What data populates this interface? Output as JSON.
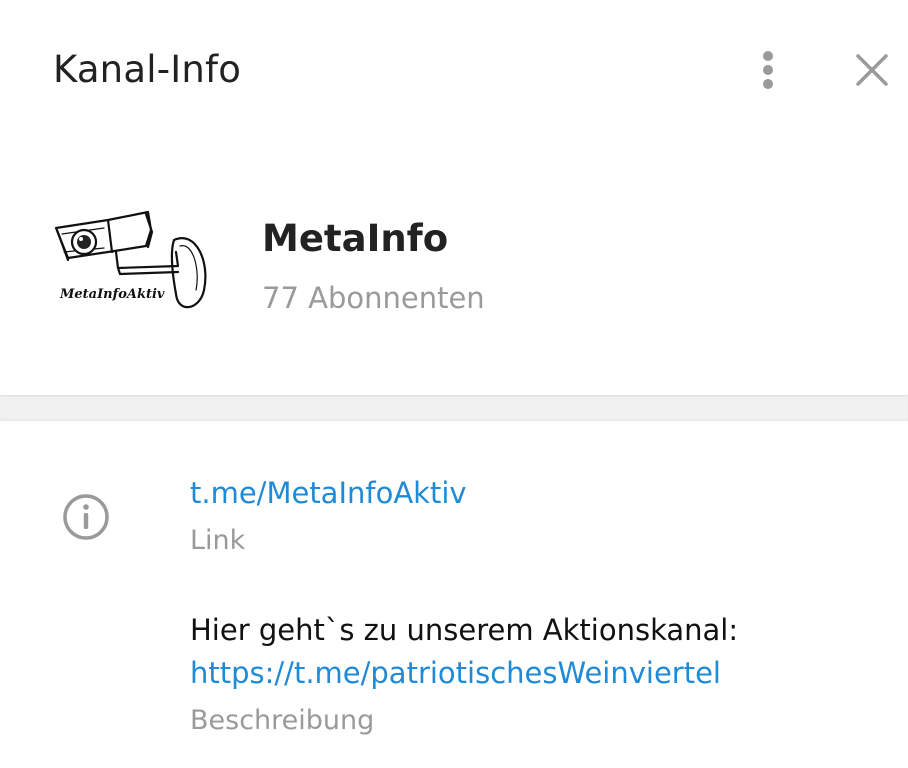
{
  "header": {
    "title": "Kanal-Info",
    "menu_icon": "more-vertical-icon",
    "close_icon": "close-icon"
  },
  "profile": {
    "avatar_icon": "security-camera-logo",
    "avatar_caption": "MetaInfoAktiv",
    "name": "MetaInfo",
    "subscribers": "77 Abonnenten"
  },
  "info": {
    "icon": "info-icon",
    "link": {
      "value": "t.me/MetaInfoAktiv",
      "label": "Link"
    },
    "description": {
      "text": "Hier geht`s zu unserem Aktionskanal:",
      "link": "https://t.me/patriotischesWeinviertel",
      "label": "Beschreibung"
    }
  },
  "colors": {
    "link": "#1f8ad6",
    "secondary_text": "#9a9a9a",
    "divider": "#f1f1f1"
  }
}
